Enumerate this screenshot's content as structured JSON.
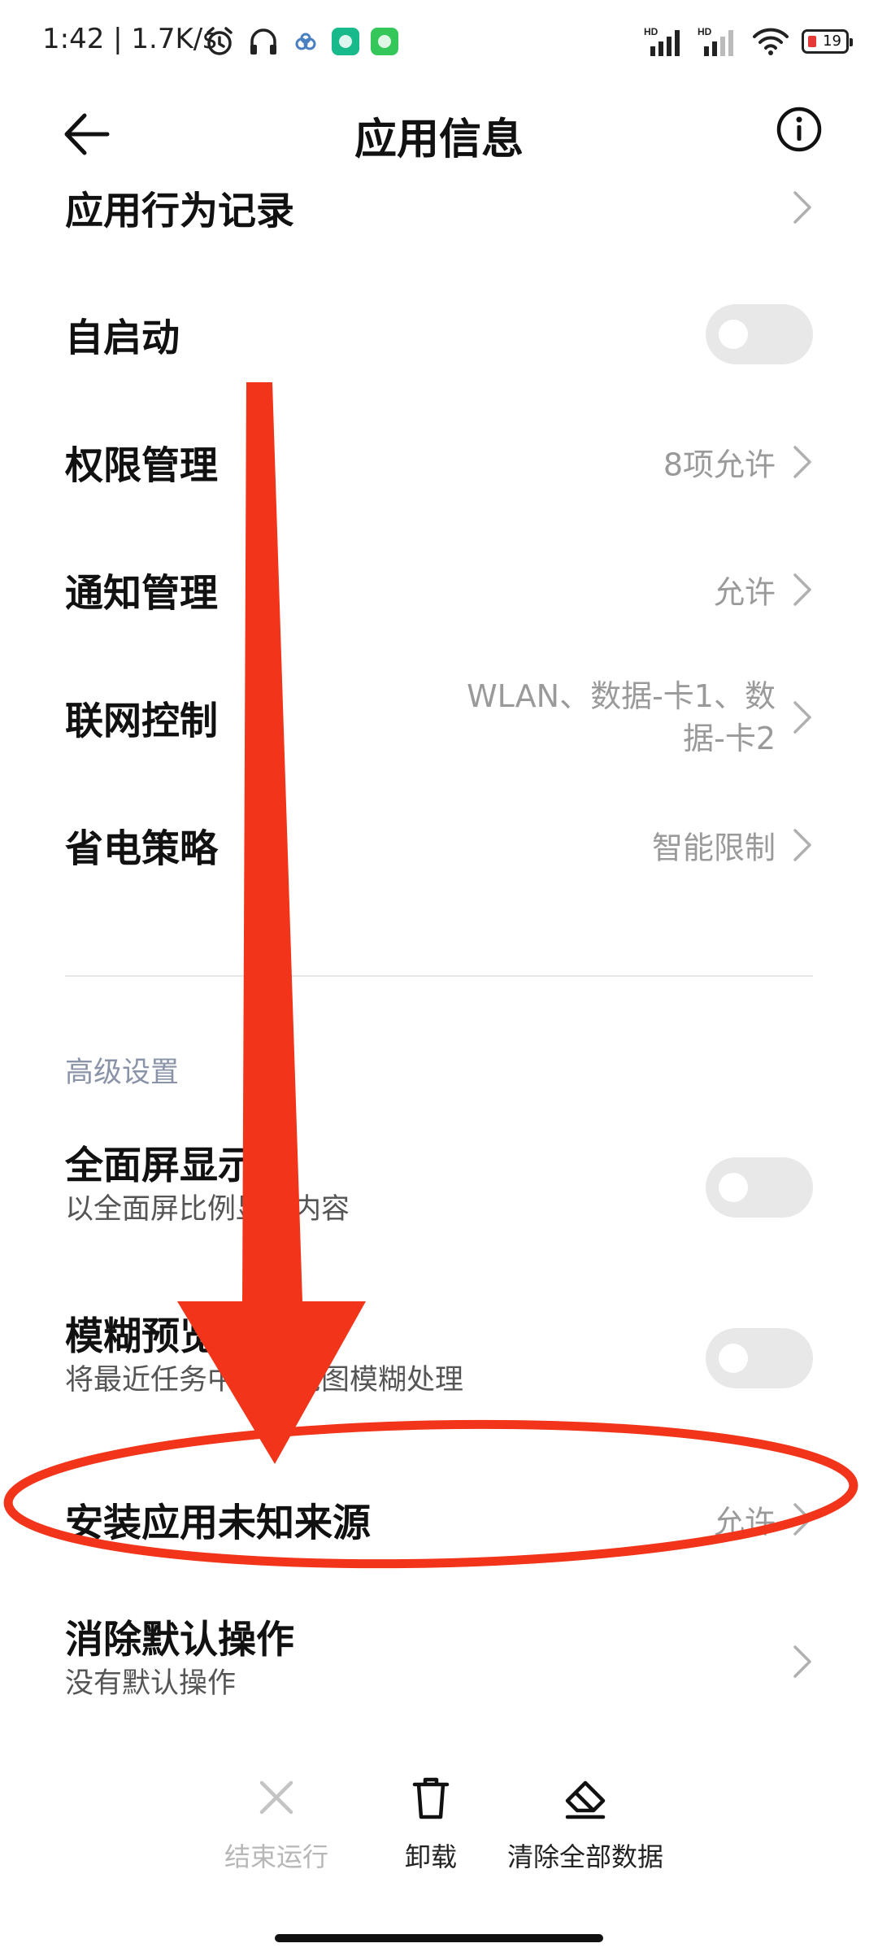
{
  "status_bar": {
    "time_speed": "1:42 | 1.7K/s",
    "battery": "19",
    "signal1": "HD",
    "signal2": "HD"
  },
  "header": {
    "title": "应用信息"
  },
  "items": [
    {
      "label": "应用行为记录"
    },
    {
      "label": "自启动"
    },
    {
      "label": "权限管理",
      "value": "8项允许"
    },
    {
      "label": "通知管理",
      "value": "允许"
    },
    {
      "label": "联网控制",
      "value_line1": "WLAN、数据-卡1、数",
      "value_line2": "据-卡2"
    },
    {
      "label": "省电策略",
      "value": "智能限制"
    }
  ],
  "advanced": {
    "header": "高级设置",
    "items": [
      {
        "label": "全面屏显示",
        "sub": "以全面屏比例显示内容"
      },
      {
        "label": "模糊预览",
        "sub": "将最近任务中的预览图模糊处理"
      },
      {
        "label": "安装应用未知来源",
        "value": "允许"
      },
      {
        "label": "消除默认操作",
        "sub": "没有默认操作"
      }
    ]
  },
  "actions": {
    "stop": "结束运行",
    "uninstall": "卸载",
    "clear": "清除全部数据"
  },
  "colors": {
    "annotation": "#f2341a",
    "toggle_off": "#e8e8e8",
    "secondary_text": "#9a9a9a"
  }
}
